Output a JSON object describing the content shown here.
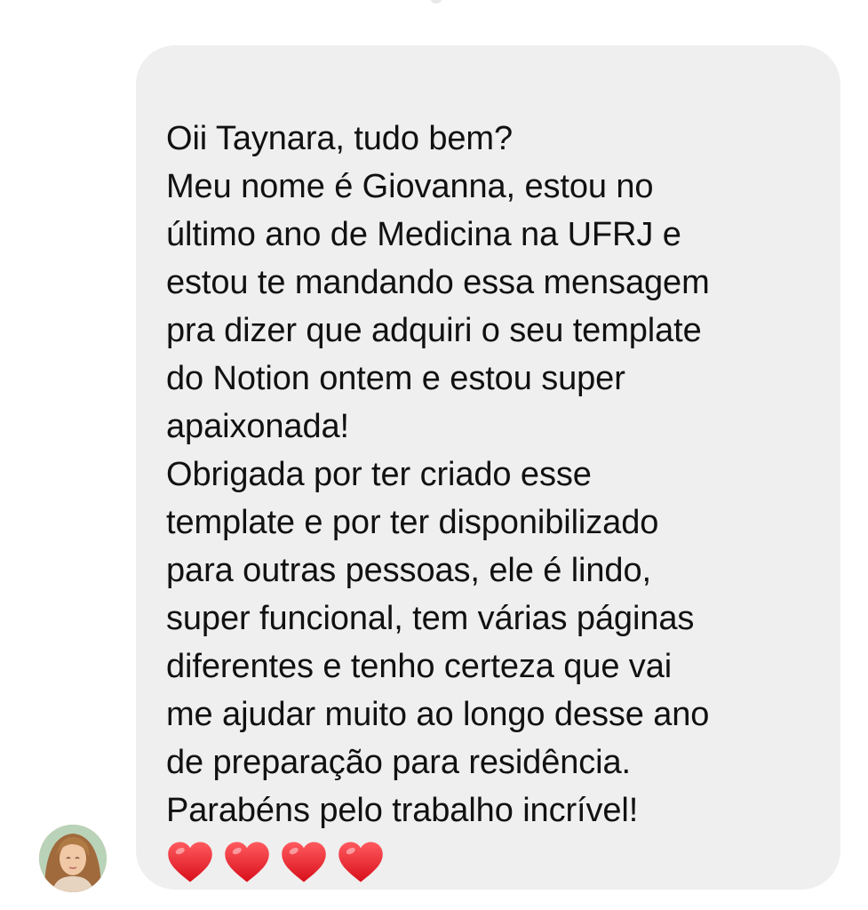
{
  "conversation": {
    "message": {
      "paragraphs": [
        {
          "lines": [
            "Oii Taynara, tudo bem?"
          ]
        },
        {
          "lines": [
            "Meu nome é Giovanna, estou no",
            "último ano de Medicina na UFRJ e",
            "estou te mandando essa mensagem",
            "pra dizer que adquiri o seu template",
            "do Notion ontem e estou super",
            "apaixonada!"
          ]
        },
        {
          "lines": [
            "Obrigada por ter criado esse",
            "template e por ter disponibilizado",
            "para outras pessoas, ele é lindo,",
            "super funcional, tem várias páginas",
            "diferentes e tenho certeza que vai",
            "me ajudar muito ao longo desse ano",
            "de preparação para residência."
          ]
        },
        {
          "lines": [
            "Parabéns pelo trabalho incrível!"
          ]
        }
      ],
      "reactions": [
        "heart-icon",
        "heart-icon",
        "heart-icon",
        "heart-icon"
      ],
      "bubble_color": "#efefef",
      "heart_color": "#ee1c25"
    },
    "sender": {
      "avatar": "avatar-photo"
    }
  }
}
